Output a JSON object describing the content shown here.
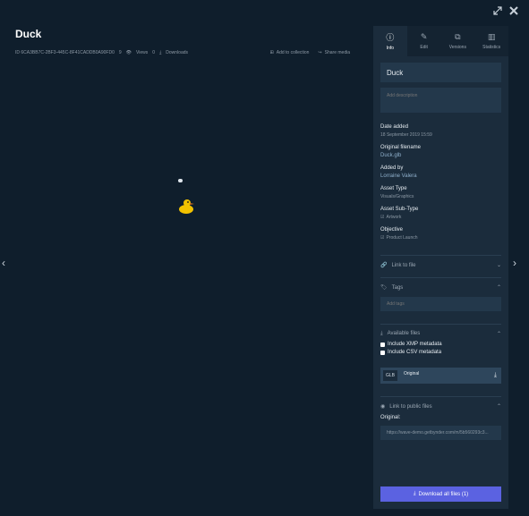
{
  "window": {
    "expand_icon": "expand-icon",
    "close_icon": "close-icon"
  },
  "asset": {
    "title": "Duck",
    "id": "ID 6CA3BB7C-2BF3-445C-8F41CADDB0A90FD0",
    "id_suffix": "9",
    "views_label": "Views",
    "views_count": "0",
    "downloads_label": "Downloads"
  },
  "actions": {
    "add_collection": "Add to collection",
    "share_media": "Share media"
  },
  "tabs": [
    {
      "label": "Info",
      "icon": "info-icon"
    },
    {
      "label": "Edit",
      "icon": "edit-icon"
    },
    {
      "label": "Versions",
      "icon": "versions-icon"
    },
    {
      "label": "Statistics",
      "icon": "statistics-icon"
    }
  ],
  "info": {
    "name_value": "Duck",
    "description_placeholder": "Add description",
    "date_added_label": "Date added",
    "date_added_value": "18 September 2019 15:59",
    "filename_label": "Original filename",
    "filename_value": "Duck.glb",
    "added_by_label": "Added by",
    "added_by_value": "Lorraine Valera",
    "asset_type_label": "Asset Type",
    "asset_type_value": "Visuals/Graphics",
    "asset_subtype_label": "Asset Sub-Type",
    "asset_subtype_value": "Artwork",
    "objective_label": "Objective",
    "objective_value": "Product Launch"
  },
  "sections": {
    "link_to_file": "Link to file",
    "tags": "Tags",
    "tags_placeholder": "Add tags",
    "available_files": "Available files",
    "include_xmp": "Include XMP metadata",
    "include_csv": "Include CSV metadata",
    "file_badge": "GLB",
    "file_name": "Original",
    "link_public": "Link to public files",
    "public_original_label": "Original:",
    "public_url": "https://wave-demo.getbynder.com/m/5b560293c3..."
  },
  "download_all": "Download all files (1)"
}
